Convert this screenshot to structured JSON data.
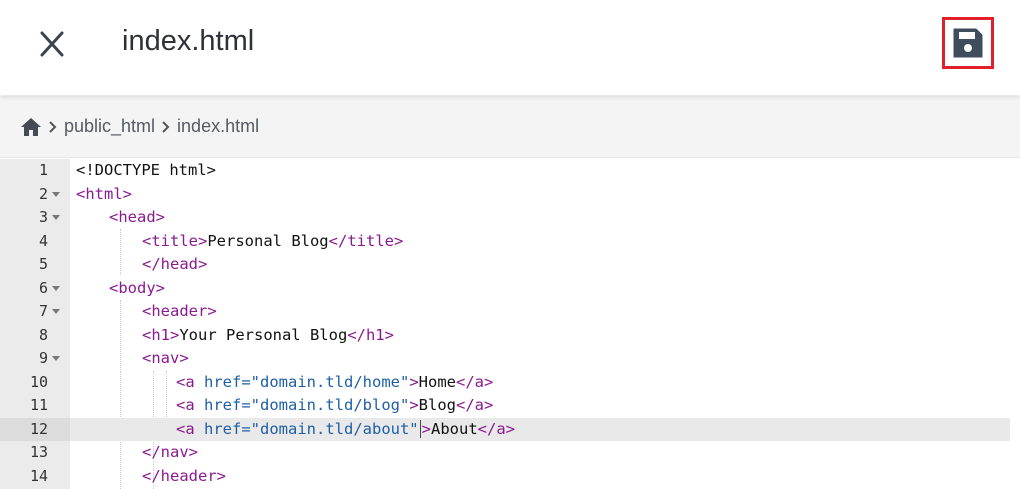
{
  "header": {
    "title": "index.html",
    "close_icon": "close-icon",
    "save_icon": "save-icon",
    "save_highlight_color": "#e0202a"
  },
  "breadcrumb": {
    "home_icon": "home-icon",
    "items": [
      "public_html",
      "index.html"
    ]
  },
  "editor": {
    "active_line": 12,
    "lines": [
      {
        "num": "1",
        "fold": false
      },
      {
        "num": "2",
        "fold": true
      },
      {
        "num": "3",
        "fold": true
      },
      {
        "num": "4",
        "fold": false
      },
      {
        "num": "5",
        "fold": false
      },
      {
        "num": "6",
        "fold": true
      },
      {
        "num": "7",
        "fold": true
      },
      {
        "num": "8",
        "fold": false
      },
      {
        "num": "9",
        "fold": true
      },
      {
        "num": "10",
        "fold": false
      },
      {
        "num": "11",
        "fold": false
      },
      {
        "num": "12",
        "fold": false
      },
      {
        "num": "13",
        "fold": false
      },
      {
        "num": "14",
        "fold": false
      }
    ],
    "code": {
      "l1": "<!DOCTYPE html>",
      "l2_tag": "<html>",
      "l3_tag": "<head>",
      "l4_open": "<title>",
      "l4_text": "Personal Blog",
      "l4_close": "</title>",
      "l5_tag": "</head>",
      "l6_tag": "<body>",
      "l7_tag": "<header>",
      "l8_open": "<h1>",
      "l8_text": "Your Personal Blog",
      "l8_close": "</h1>",
      "l9_tag": "<nav>",
      "l10_open": "<a ",
      "l10_attr": "href=",
      "l10_val": "\"domain.tld/home\"",
      "l10_gt": ">",
      "l10_text": "Home",
      "l10_close": "</a>",
      "l11_open": "<a ",
      "l11_attr": "href=",
      "l11_val": "\"domain.tld/blog\"",
      "l11_gt": ">",
      "l11_text": "Blog",
      "l11_close": "</a>",
      "l12_open": "<a ",
      "l12_attr": "href=",
      "l12_val": "\"domain.tld/about\"",
      "l12_gt": ">",
      "l12_text": "About",
      "l12_close": "</a>",
      "l13_tag": "</nav>",
      "l14_tag": "</header>"
    }
  }
}
